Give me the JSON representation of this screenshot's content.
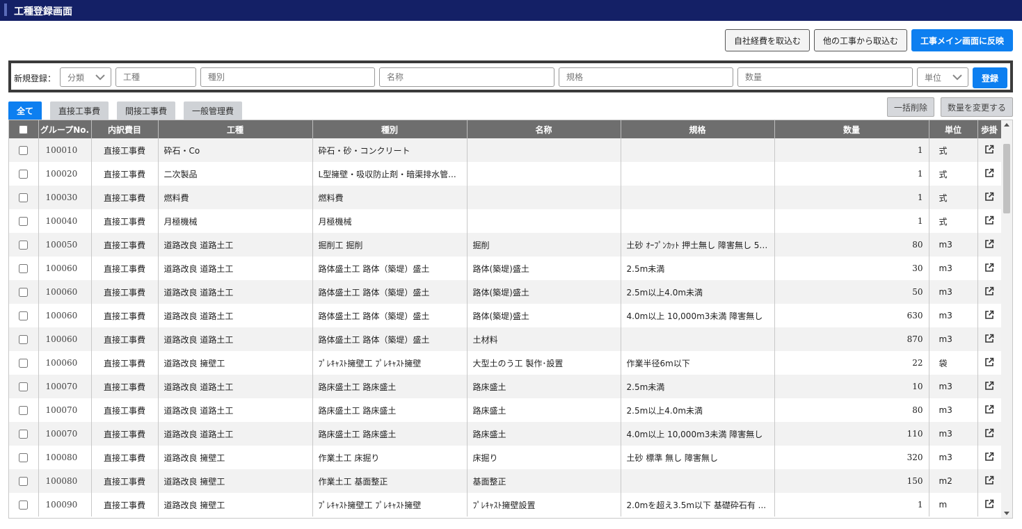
{
  "header": {
    "title": "工種登録画面"
  },
  "top_buttons": {
    "import_own": "自社経費を取込む",
    "import_other": "他の工事から取込む",
    "reflect_main": "工事メイン画面に反映"
  },
  "register": {
    "label": "新規登録：",
    "category": "分類",
    "koushu": "工種",
    "shubetsu": "種別",
    "name": "名称",
    "kikaku": "規格",
    "quantity": "数量",
    "unit": "単位",
    "submit": "登録"
  },
  "tabs": [
    {
      "label": "全て"
    },
    {
      "label": "直接工事費"
    },
    {
      "label": "間接工事費"
    },
    {
      "label": "一般管理費"
    }
  ],
  "actions": {
    "bulk_delete": "一括削除",
    "change_qty": "数量を変更する"
  },
  "table": {
    "headers": [
      "グループNo.",
      "内訳費目",
      "工種",
      "種別",
      "名称",
      "規格",
      "数量",
      "単位",
      "歩掛"
    ],
    "rows": [
      {
        "group": "100010",
        "cat": "直接工事費",
        "koushu": "砕石・Co",
        "shubetsu": "砕石・砂・コンクリート",
        "name": "",
        "spec": "",
        "qty": "1",
        "unit": "式"
      },
      {
        "group": "100020",
        "cat": "直接工事費",
        "koushu": "二次製品",
        "shubetsu": "L型擁壁・吸収防止剤・暗渠排水管...",
        "name": "",
        "spec": "",
        "qty": "1",
        "unit": "式"
      },
      {
        "group": "100030",
        "cat": "直接工事費",
        "koushu": "燃料費",
        "shubetsu": "燃料費",
        "name": "",
        "spec": "",
        "qty": "1",
        "unit": "式"
      },
      {
        "group": "100040",
        "cat": "直接工事費",
        "koushu": "月極機械",
        "shubetsu": "月極機械",
        "name": "",
        "spec": "",
        "qty": "1",
        "unit": "式"
      },
      {
        "group": "100050",
        "cat": "直接工事費",
        "koushu": "道路改良 道路土工",
        "shubetsu": "掘削工 掘削",
        "name": "掘削",
        "spec": "土砂 ｵｰﾌﾟﾝｶｯﾄ 押土無し 障害無し 5,...",
        "qty": "80",
        "unit": "m3"
      },
      {
        "group": "100060",
        "cat": "直接工事費",
        "koushu": "道路改良 道路土工",
        "shubetsu": "路体盛土工 路体（築堤）盛土",
        "name": "路体(築堤)盛土",
        "spec": "2.5m未満",
        "qty": "30",
        "unit": "m3"
      },
      {
        "group": "100060",
        "cat": "直接工事費",
        "koushu": "道路改良 道路土工",
        "shubetsu": "路体盛土工 路体（築堤）盛土",
        "name": "路体(築堤)盛土",
        "spec": "2.5m以上4.0m未満",
        "qty": "50",
        "unit": "m3"
      },
      {
        "group": "100060",
        "cat": "直接工事費",
        "koushu": "道路改良 道路土工",
        "shubetsu": "路体盛土工 路体（築堤）盛土",
        "name": "路体(築堤)盛土",
        "spec": "4.0m以上 10,000m3未満 障害無し",
        "qty": "630",
        "unit": "m3"
      },
      {
        "group": "100060",
        "cat": "直接工事費",
        "koushu": "道路改良 道路土工",
        "shubetsu": "路体盛土工 路体（築堤）盛土",
        "name": "土材料",
        "spec": "",
        "qty": "870",
        "unit": "m3"
      },
      {
        "group": "100060",
        "cat": "直接工事費",
        "koushu": "道路改良 擁壁工",
        "shubetsu": "ﾌﾟﾚｷｬｽﾄ擁壁工 ﾌﾟﾚｷｬｽﾄ擁壁",
        "name": "大型土のう工 製作･設置",
        "spec": "作業半径6m以下",
        "qty": "22",
        "unit": "袋"
      },
      {
        "group": "100070",
        "cat": "直接工事費",
        "koushu": "道路改良 道路土工",
        "shubetsu": "路床盛土工 路床盛土",
        "name": "路床盛土",
        "spec": "2.5m未満",
        "qty": "10",
        "unit": "m3"
      },
      {
        "group": "100070",
        "cat": "直接工事費",
        "koushu": "道路改良 道路土工",
        "shubetsu": "路床盛土工 路床盛土",
        "name": "路床盛土",
        "spec": "2.5m以上4.0m未満",
        "qty": "80",
        "unit": "m3"
      },
      {
        "group": "100070",
        "cat": "直接工事費",
        "koushu": "道路改良 道路土工",
        "shubetsu": "路床盛土工 路床盛土",
        "name": "路床盛土",
        "spec": "4.0m以上 10,000m3未満 障害無し",
        "qty": "110",
        "unit": "m3"
      },
      {
        "group": "100080",
        "cat": "直接工事費",
        "koushu": "道路改良 擁壁工",
        "shubetsu": "作業土工 床掘り",
        "name": "床掘り",
        "spec": "土砂 標準 無し 障害無し",
        "qty": "320",
        "unit": "m3"
      },
      {
        "group": "100080",
        "cat": "直接工事費",
        "koushu": "道路改良 擁壁工",
        "shubetsu": "作業土工 基面整正",
        "name": "基面整正",
        "spec": "",
        "qty": "150",
        "unit": "m2"
      },
      {
        "group": "100090",
        "cat": "直接工事費",
        "koushu": "道路改良 擁壁工",
        "shubetsu": "ﾌﾟﾚｷｬｽﾄ擁壁工 ﾌﾟﾚｷｬｽﾄ擁壁",
        "name": "ﾌﾟﾚｷｬｽﾄ擁壁設置",
        "spec": "2.0mを超え3.5m以下 基礎砕石有 ...",
        "qty": "1",
        "unit": "m"
      }
    ]
  }
}
